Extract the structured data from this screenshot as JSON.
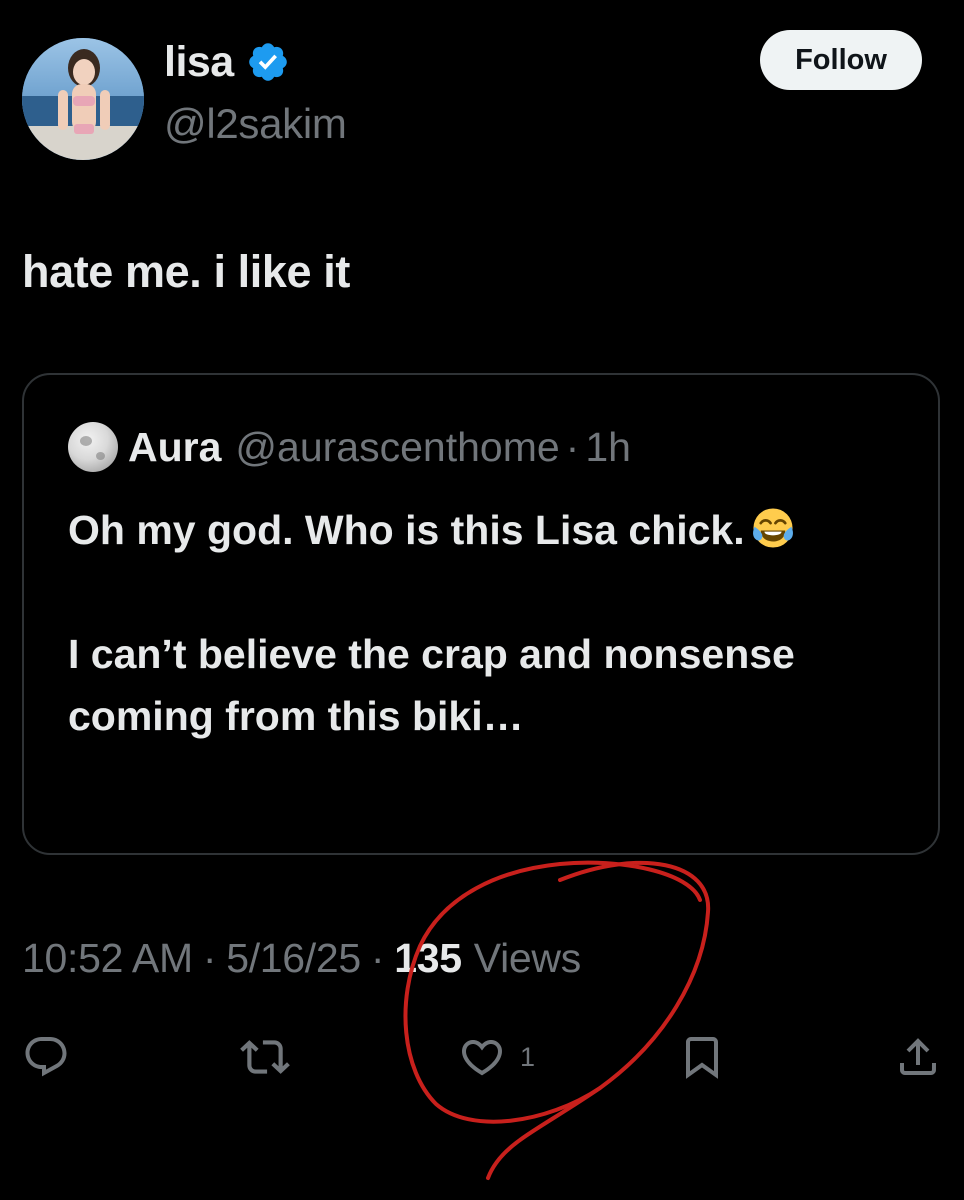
{
  "tweet": {
    "author": {
      "name": "lisa",
      "handle": "@l2sakim",
      "verified": true,
      "avatar": "profile photo"
    },
    "follow_label": "Follow",
    "text": "hate me. i like it",
    "quote": {
      "author_name": "Aura",
      "author_handle": "@aurascenthome",
      "separator": "·",
      "time": "1h",
      "body_line1": "Oh my god. Who is this Lisa chick.",
      "emoji": "face-with-tears-of-joy",
      "body_line2": "I can’t believe the crap and nonsense coming from this biki…"
    },
    "meta": {
      "time": "10:52 AM",
      "separator": "·",
      "date": "5/16/25",
      "views_count": "135",
      "views_label": "Views"
    },
    "actions": {
      "reply_icon": "reply-icon",
      "retweet_icon": "retweet-icon",
      "like_icon": "heart-icon",
      "like_count": "1",
      "bookmark_icon": "bookmark-icon",
      "share_icon": "share-icon"
    }
  },
  "colors": {
    "background": "#000000",
    "text_primary": "#e7e9ea",
    "text_muted": "#71767b",
    "verified_blue": "#1d9bf0",
    "border": "#2f3336",
    "annotation_red": "#c8201c"
  }
}
